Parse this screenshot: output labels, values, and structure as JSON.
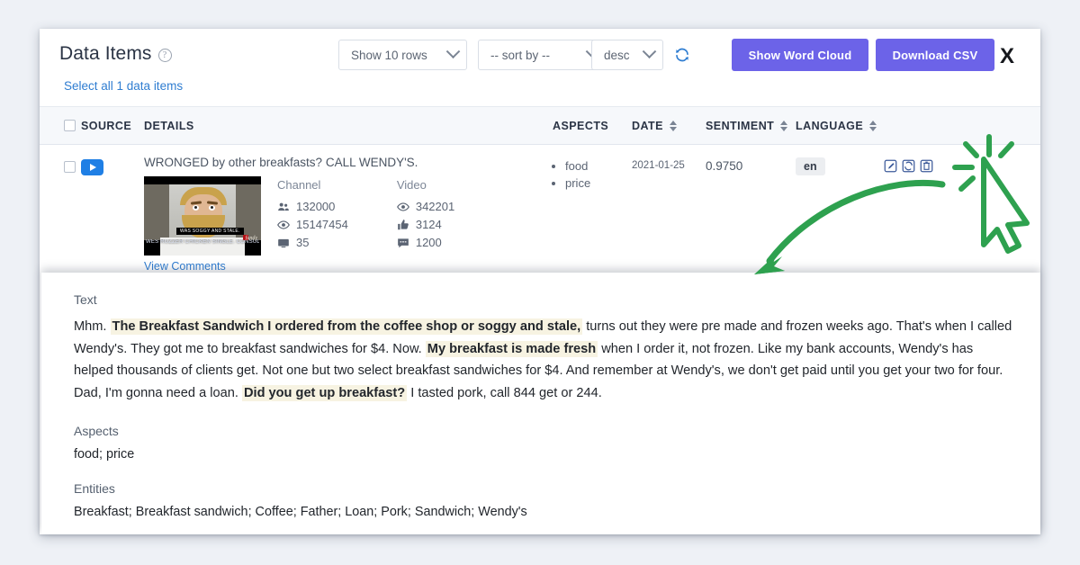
{
  "header": {
    "title": "Data Items",
    "help_icon": "question-circle-icon",
    "select_all_label": "Select all 1 data items",
    "rows_select": "Show 10 rows",
    "sort_select": "-- sort by --",
    "dir_select": "desc",
    "refresh_icon": "refresh-icon",
    "word_cloud_button": "Show Word Cloud",
    "download_csv_button": "Download CSV",
    "close_button": "X",
    "accent_color": "#6c63e8",
    "link_color": "#2f7dd1"
  },
  "table": {
    "columns": [
      {
        "label": "",
        "name": "select"
      },
      {
        "label": "SOURCE",
        "name": "source"
      },
      {
        "label": "DETAILS",
        "name": "details"
      },
      {
        "label": "ASPECTS",
        "name": "aspects"
      },
      {
        "label": "DATE",
        "name": "date",
        "sortable": true
      },
      {
        "label": "SENTIMENT",
        "name": "sentiment",
        "sortable": true
      },
      {
        "label": "LANGUAGE",
        "name": "language",
        "sortable": true
      },
      {
        "label": "",
        "name": "actions"
      }
    ],
    "row": {
      "source_icon": "youtube-play-icon",
      "detail_title": "WRONGED by other breakfasts? CALL WENDY'S.",
      "thumbnail_caption_1": "WAS SOGGY AND STALE.",
      "thumbnail_caption_2": "WES RUZZER CHICKEN SINGLE. CONSULTANTS.",
      "thumbnail_logo": "fundy",
      "view_comments_label": "View Comments",
      "channel_heading": "Channel",
      "video_heading": "Video",
      "channel_subscribers": "132000",
      "channel_views": "15147454",
      "channel_videos": "35",
      "video_views": "342201",
      "video_likes": "3124",
      "video_comments": "1200",
      "aspects": [
        "food",
        "price"
      ],
      "date": "2021-01-25",
      "sentiment": "0.9750",
      "language": "en",
      "action_icons": [
        "edit-icon",
        "reprocess-icon",
        "delete-icon"
      ]
    }
  },
  "details": {
    "text_heading": "Text",
    "text_parts": [
      {
        "t": "Mhm. ",
        "h": false
      },
      {
        "t": "The Breakfast Sandwich I ordered from the coffee shop or soggy and stale,",
        "h": true
      },
      {
        "t": " turns out they were pre made and frozen weeks ago. That's when I called Wendy's. They got me to breakfast sandwiches for $4. Now. ",
        "h": false
      },
      {
        "t": "My breakfast is made fresh",
        "h": true
      },
      {
        "t": " when I order it, not frozen. Like my bank accounts, Wendy's has helped thousands of clients get. Not one but two select breakfast sandwiches for $4. And remember at Wendy's, we don't get paid until you get your two for four. Dad, I'm gonna need a loan. ",
        "h": false
      },
      {
        "t": "Did you get up breakfast?",
        "h": true
      },
      {
        "t": " I tasted pork, call 844 get or 244.",
        "h": false
      }
    ],
    "aspects_heading": "Aspects",
    "aspects_value": "food; price",
    "entities_heading": "Entities",
    "entities_value": "Breakfast; Breakfast sandwich; Coffee; Father; Loan; Pork; Sandwich; Wendy's",
    "highlight_color": "#f7f3e2"
  },
  "annotation": {
    "cursor_icon": "mouse-cursor-pointer",
    "arrow_icon": "curved-arrow",
    "color": "#2eA14f"
  }
}
